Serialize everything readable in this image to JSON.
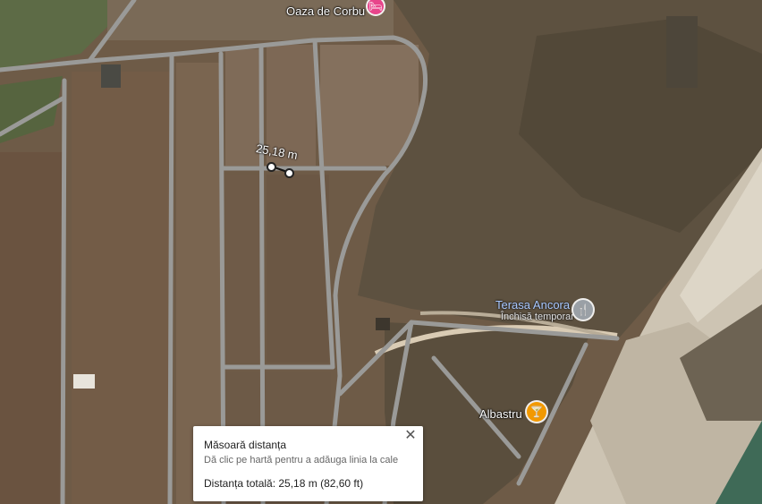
{
  "map": {
    "places": {
      "oaza": {
        "name": "Oaza de Corbu",
        "icon": "hotel-icon",
        "color": "#e8458b"
      },
      "terasa": {
        "name": "Terasa Ancora",
        "status": "Închisă temporar",
        "icon": "restaurant-icon",
        "color": "#9aa0a6"
      },
      "albastru": {
        "name": "Albastru",
        "icon": "cocktail-bar-icon",
        "color": "#f29900"
      }
    },
    "measurement": {
      "segment_label": "25,18 m"
    }
  },
  "measure_panel": {
    "title": "Măsoară distanța",
    "hint": "Dă clic pe hartă pentru a adăuga linia la cale",
    "total": "Distanța totală: 25,18 m (82,60 ft)",
    "close_icon": "close-icon"
  }
}
